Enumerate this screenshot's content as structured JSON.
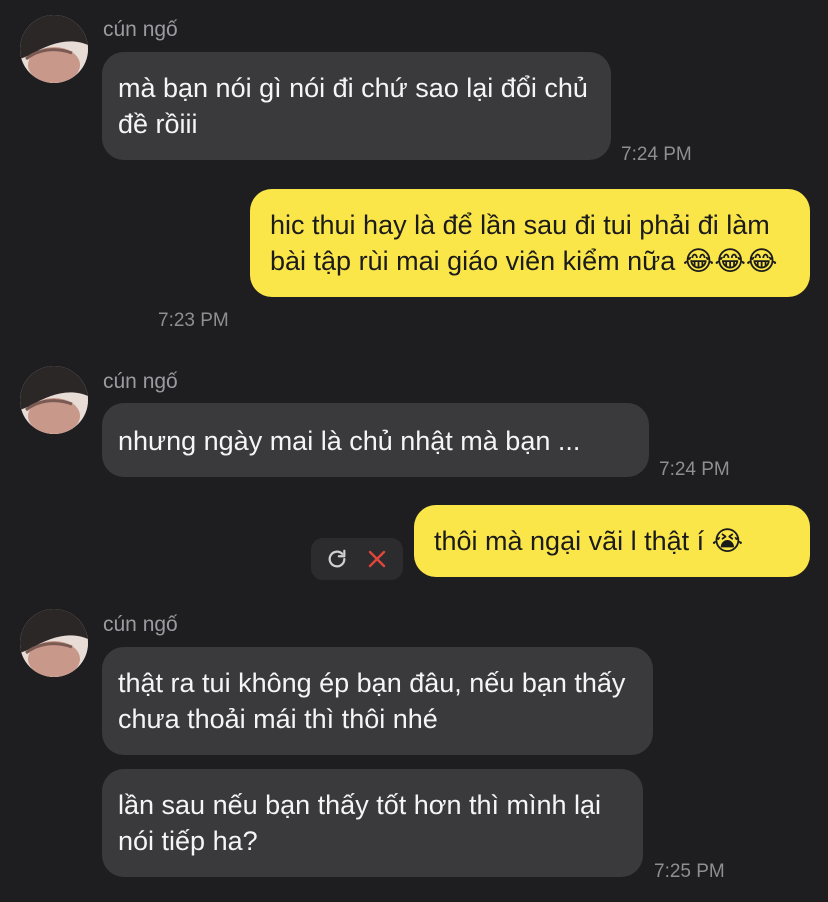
{
  "conversation": {
    "contact_name": "cún ngố",
    "messages": [
      {
        "id": "m1",
        "direction": "in",
        "sender": "cún ngố",
        "text": "mà bạn nói gì nói đi chứ sao lại đổi chủ đề rồiii",
        "time": "7:24 PM"
      },
      {
        "id": "m2",
        "direction": "out",
        "text": "hic thui hay là để lần sau đi tui phải đi làm bài tập rùi mai giáo viên kiểm nữa 😂😂😂",
        "time": "7:23 PM"
      },
      {
        "id": "m3",
        "direction": "in",
        "sender": "cún ngố",
        "text": "nhưng ngày mai là chủ nhật mà bạn ...",
        "time": "7:24 PM"
      },
      {
        "id": "m4",
        "direction": "out",
        "text": "thôi mà ngại vãi l thật í 😭",
        "status": "failed"
      },
      {
        "id": "m5",
        "direction": "in",
        "sender": "cún ngố",
        "text": "thật ra tui không ép bạn đâu, nếu bạn thấy chưa thoải mái thì thôi nhé"
      },
      {
        "id": "m6",
        "direction": "in",
        "text": "lần sau nếu bạn thấy tốt hơn thì mình lại nói tiếp ha?",
        "time": "7:25 PM"
      }
    ]
  },
  "icons": {
    "retry": "retry-icon",
    "delete": "close-icon"
  },
  "colors": {
    "background": "#1e1e20",
    "incoming_bubble": "#3a3a3c",
    "outgoing_bubble": "#fbe64a",
    "failed_icon": "#e0453a",
    "timestamp": "#8e8e93"
  }
}
